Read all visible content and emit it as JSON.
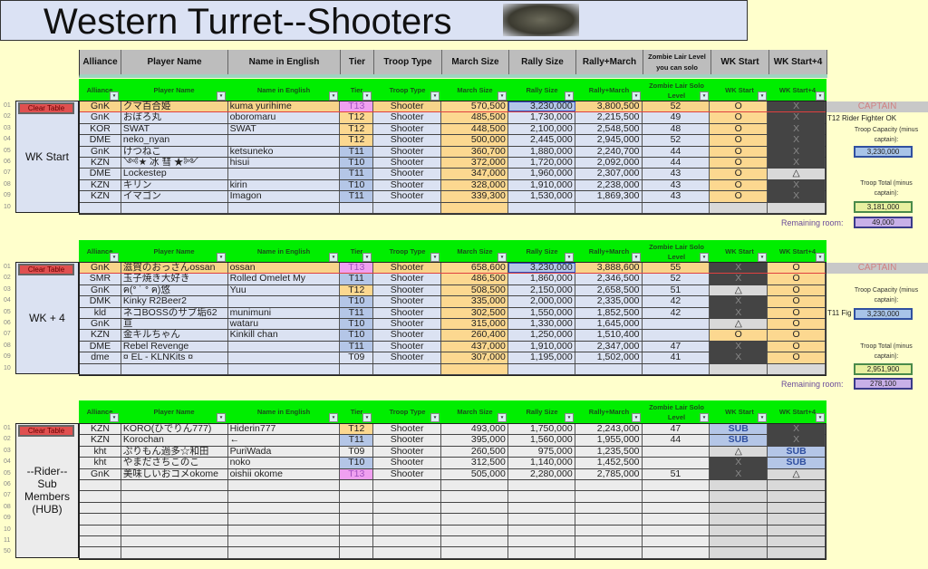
{
  "title": "Western Turret--Shooters",
  "top_headers": [
    "Alliance",
    "Player Name",
    "Name in English",
    "Tier",
    "Troop Type",
    "March Size",
    "Rally Size",
    "Rally+March",
    "Zombie Lair Level you can solo",
    "WK Start",
    "WK Start+4"
  ],
  "table_headers": [
    "Alliance",
    "Player Name",
    "Name in English",
    "Tier",
    "Troop Type",
    "March Size",
    "Rally Size",
    "Rally+March",
    "Zombie Lair Solo Level",
    "WK Start",
    "WK Start+4"
  ],
  "clear_label": "Clear Table",
  "colors": {
    "header_green": "#00ee00",
    "row_blue": "#dbe2f2",
    "orange": "#fcd890",
    "dark": "#444444",
    "sub": "#b4c6e7",
    "t13": "#f0a0f0"
  },
  "sections": [
    {
      "label": "WK Start",
      "row_numbers": [
        "01",
        "02",
        "03",
        "04",
        "05",
        "06",
        "07",
        "08",
        "09",
        "10"
      ],
      "rows": [
        [
          "GnK",
          "クマ百合姫",
          "kuma yurihime",
          "T13",
          "Shooter",
          "570,500",
          "3,230,000",
          "3,800,500",
          "52",
          "O",
          "X"
        ],
        [
          "GnK",
          "おぼろ丸",
          "oboromaru",
          "T12",
          "Shooter",
          "485,500",
          "1,730,000",
          "2,215,500",
          "49",
          "O",
          "X"
        ],
        [
          "KOR",
          "SWAT",
          "SWAT",
          "T12",
          "Shooter",
          "448,500",
          "2,100,000",
          "2,548,500",
          "48",
          "O",
          "X"
        ],
        [
          "DME",
          "neko_nyan",
          "",
          "T12",
          "Shooter",
          "500,000",
          "2,445,000",
          "2,945,000",
          "52",
          "O",
          "X"
        ],
        [
          "GnK",
          "けつねこ",
          "ketsuneko",
          "T11",
          "Shooter",
          "360,700",
          "1,880,000",
          "2,240,700",
          "44",
          "O",
          "X"
        ],
        [
          "KZN",
          "༺★ 冰 彗 ★༻",
          "hisui",
          "T10",
          "Shooter",
          "372,000",
          "1,720,000",
          "2,092,000",
          "44",
          "O",
          "X"
        ],
        [
          "DME",
          "Lockestep",
          "",
          "T11",
          "Shooter",
          "347,000",
          "1,960,000",
          "2,307,000",
          "43",
          "O",
          "△"
        ],
        [
          "KZN",
          "キリン",
          "kirin",
          "T10",
          "Shooter",
          "328,000",
          "1,910,000",
          "2,238,000",
          "43",
          "O",
          "X"
        ],
        [
          "KZN",
          "イマゴン",
          "Imagon",
          "T11",
          "Shooter",
          "339,300",
          "1,530,000",
          "1,869,300",
          "43",
          "O",
          "X"
        ],
        [
          "",
          "",
          "",
          "",
          "",
          "",
          "",
          "",
          "",
          "",
          ""
        ]
      ],
      "side": {
        "captain": "CAPTAIN",
        "note": "T12 Rider Fighter OK",
        "capacity_label": "Troop Capacity (minus captain):",
        "capacity": "3,230,000",
        "total_label": "Troop Total (minus captain):",
        "total": "3,181,000",
        "remaining_label": "Remaining room:",
        "remaining": "49,000"
      }
    },
    {
      "label": "WK + 4",
      "row_numbers": [
        "01",
        "02",
        "03",
        "04",
        "05",
        "06",
        "07",
        "08",
        "09",
        "10"
      ],
      "rows": [
        [
          "GnK",
          "滋賀のおっさんossan",
          "ossan",
          "T13",
          "Shooter",
          "658,600",
          "3,230,000",
          "3,888,600",
          "55",
          "X",
          "O"
        ],
        [
          "SMR",
          "玉子焼き大好き",
          "Rolled Omelet My",
          "T11",
          "Shooter",
          "486,500",
          "1,860,000",
          "2,346,500",
          "52",
          "X",
          "O"
        ],
        [
          "GnK",
          "ฅ(ᐤ ˙ ᐤ ฅ)悠",
          "Yuu",
          "T12",
          "Shooter",
          "508,500",
          "2,150,000",
          "2,658,500",
          "51",
          "△",
          "O"
        ],
        [
          "DMK",
          "Kinky R2Beer2",
          "",
          "T10",
          "Shooter",
          "335,000",
          "2,000,000",
          "2,335,000",
          "42",
          "X",
          "O"
        ],
        [
          "kld",
          "ネコBOSSのサブ垢62",
          "munimuni",
          "T11",
          "Shooter",
          "302,500",
          "1,550,000",
          "1,852,500",
          "42",
          "X",
          "O"
        ],
        [
          "GnK",
          "亘",
          "wataru",
          "T10",
          "Shooter",
          "315,000",
          "1,330,000",
          "1,645,000",
          "",
          "△",
          "O"
        ],
        [
          "KZN",
          "金キルちゃん",
          "Kinkill chan",
          "T10",
          "Shooter",
          "260,400",
          "1,250,000",
          "1,510,400",
          "",
          "O",
          "O"
        ],
        [
          "DME",
          "Rebel Revenge",
          "",
          "T11",
          "Shooter",
          "437,000",
          "1,910,000",
          "2,347,000",
          "47",
          "X",
          "O"
        ],
        [
          "dme",
          "¤ EL - KLNKits ¤",
          "",
          "T09",
          "Shooter",
          "307,000",
          "1,195,000",
          "1,502,000",
          "41",
          "X",
          "O"
        ],
        [
          "",
          "",
          "",
          "",
          "",
          "",
          "",
          "",
          "",
          "",
          ""
        ]
      ],
      "side": {
        "captain": "CAPTAIN",
        "note": "T11 Fig",
        "capacity_label": "Troop Capacity (minus captain):",
        "capacity": "3,230,000",
        "total_label": "Troop Total (minus captain):",
        "total": "2,951,900",
        "remaining_label": "Remaining room:",
        "remaining": "278,100"
      }
    },
    {
      "label": "--Rider-- Sub Members (HUB)",
      "row_numbers": [
        "01",
        "02",
        "03",
        "04",
        "05",
        "06",
        "07",
        "08",
        "09",
        "10",
        "11",
        "50"
      ],
      "rows": [
        [
          "KZN",
          "KORO(ひでりん777)",
          "Hiderin777",
          "T12",
          "Shooter",
          "493,000",
          "1,750,000",
          "2,243,000",
          "47",
          "SUB",
          "X"
        ],
        [
          "KZN",
          "Korochan",
          "←",
          "T11",
          "Shooter",
          "395,000",
          "1,560,000",
          "1,955,000",
          "44",
          "SUB",
          "X"
        ],
        [
          "kht",
          "ぷりもん過多☆和田",
          "PuriWada",
          "T09",
          "Shooter",
          "260,500",
          "975,000",
          "1,235,500",
          "",
          "△",
          "SUB"
        ],
        [
          "kht",
          "やまださちこのこ",
          "noko",
          "T10",
          "Shooter",
          "312,500",
          "1,140,000",
          "1,452,500",
          "",
          "X",
          "SUB"
        ],
        [
          "GnK",
          "美味しいおコメokome",
          "oishii okome",
          "T13",
          "Shooter",
          "505,000",
          "2,280,000",
          "2,785,000",
          "51",
          "X",
          "△"
        ],
        [
          "",
          "",
          "",
          "",
          "",
          "",
          "",
          "",
          "",
          "",
          ""
        ],
        [
          "",
          "",
          "",
          "",
          "",
          "",
          "",
          "",
          "",
          "",
          ""
        ],
        [
          "",
          "",
          "",
          "",
          "",
          "",
          "",
          "",
          "",
          "",
          ""
        ],
        [
          "",
          "",
          "",
          "",
          "",
          "",
          "",
          "",
          "",
          "",
          ""
        ],
        [
          "",
          "",
          "",
          "",
          "",
          "",
          "",
          "",
          "",
          "",
          ""
        ],
        [
          "",
          "",
          "",
          "",
          "",
          "",
          "",
          "",
          "",
          "",
          ""
        ],
        [
          "",
          "",
          "",
          "",
          "",
          "",
          "",
          "",
          "",
          "",
          ""
        ]
      ]
    }
  ]
}
